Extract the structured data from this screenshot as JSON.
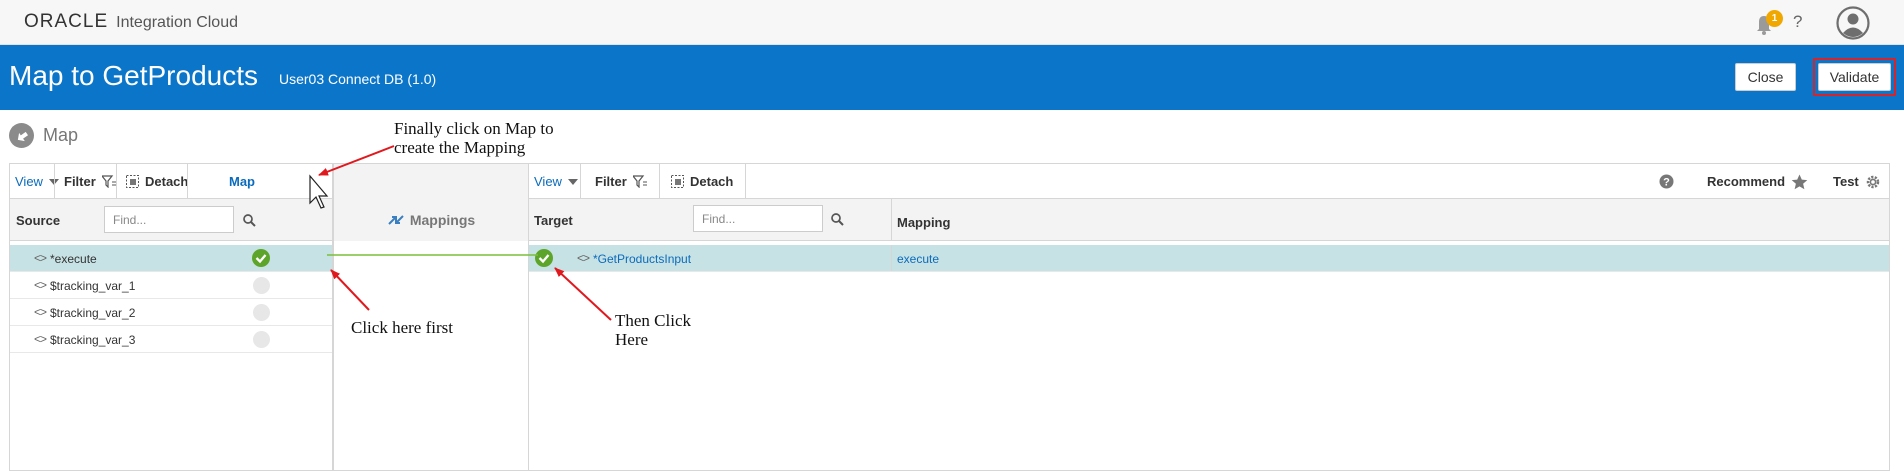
{
  "header": {
    "brand": "ORACLE",
    "product": "Integration Cloud",
    "notifications_count": "1",
    "help": "?",
    "icons": [
      "bell-icon",
      "help-icon",
      "user-avatar-icon"
    ]
  },
  "titlebar": {
    "title": "Map to GetProducts",
    "subtitle": "User03 Connect DB (1.0)",
    "close_label": "Close",
    "validate_label": "Validate"
  },
  "map_header": {
    "label": "Map"
  },
  "source_panel": {
    "toolbar": {
      "view_label": "View",
      "filter_label": "Filter",
      "detach_label": "Detach",
      "map_label": "Map"
    },
    "column_label": "Source",
    "search_placeholder": "Find...",
    "rows": [
      {
        "code": "<>",
        "name": "*execute",
        "mapped": true
      },
      {
        "code": "<>",
        "name": "$tracking_var_1",
        "mapped": false
      },
      {
        "code": "<>",
        "name": "$tracking_var_2",
        "mapped": false
      },
      {
        "code": "<>",
        "name": "$tracking_var_3",
        "mapped": false
      }
    ]
  },
  "mappings_panel": {
    "label": "Mappings"
  },
  "target_panel": {
    "toolbar": {
      "view_label": "View",
      "filter_label": "Filter",
      "detach_label": "Detach",
      "recommend_label": "Recommend",
      "test_label": "Test"
    },
    "target_column_label": "Target",
    "mapping_column_label": "Mapping",
    "search_placeholder": "Find...",
    "rows": [
      {
        "code": "<>",
        "name": "*GetProductsInput",
        "mapping": "execute",
        "mapped": true
      }
    ]
  },
  "annotations": {
    "map_note_line1": "Finally click on Map to",
    "map_note_line2": "create the Mapping",
    "source_note": "Click here first",
    "target_note_line1": "Then Click",
    "target_note_line2": "Here"
  },
  "colors": {
    "title_bar": "#0b76c9",
    "mapped_check": "#5da52a",
    "selected_row": "#c7e2e4",
    "annotation_arrow": "#e0191f",
    "validate_highlight": "#d5252a",
    "link_line": "#7bbf3a"
  }
}
